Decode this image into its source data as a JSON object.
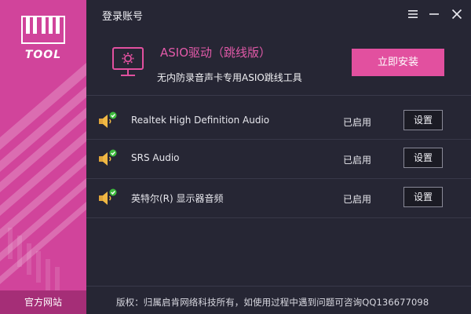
{
  "window": {
    "title": "登录账号"
  },
  "sidebar": {
    "logo_text": "TOOL",
    "official_site_label": "官方网站",
    "accent_color": "#d1449b"
  },
  "product": {
    "name": "ASIO驱动（跳线版）",
    "description": "无内防录音声卡专用ASIO跳线工具",
    "install_label": "立即安装",
    "icon": "monitor-settings-icon",
    "accent_color": "#e2509f"
  },
  "devices": [
    {
      "name": "Realtek High Definition Audio",
      "status": "已启用",
      "settings_label": "设置",
      "icon": "speaker-check-icon"
    },
    {
      "name": "SRS Audio",
      "status": "已启用",
      "settings_label": "设置",
      "icon": "speaker-check-icon"
    },
    {
      "name": "英特尔(R) 显示器音频",
      "status": "已启用",
      "settings_label": "设置",
      "icon": "speaker-check-icon"
    }
  ],
  "footer": {
    "copyright": "版权：归属启肯网络科技所有，如使用过程中遇到问题可咨询QQ136677098"
  }
}
